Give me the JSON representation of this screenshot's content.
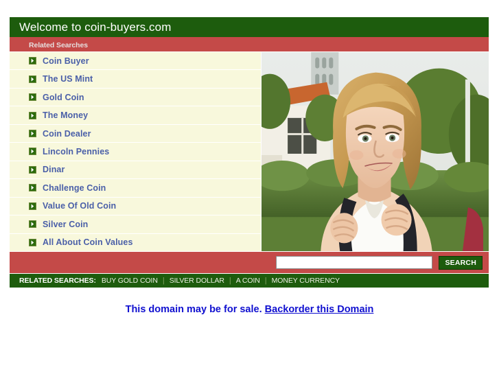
{
  "header": {
    "title": "Welcome to coin-buyers.com",
    "subhead": "Related Searches"
  },
  "colors": {
    "header_green": "#1d5c0d",
    "bar_red": "#c44a48",
    "list_cream": "#f8f8dc",
    "link_blue": "#4a5fa8",
    "notice_blue": "#1010d0"
  },
  "related_links": [
    {
      "label": "Coin Buyer"
    },
    {
      "label": "The US Mint"
    },
    {
      "label": "Gold Coin"
    },
    {
      "label": "The Money"
    },
    {
      "label": "Coin Dealer"
    },
    {
      "label": "Lincoln Pennies"
    },
    {
      "label": "Dinar"
    },
    {
      "label": "Challenge Coin"
    },
    {
      "label": "Value Of Old Coin"
    },
    {
      "label": "Silver Coin"
    },
    {
      "label": "All About Coin Values"
    }
  ],
  "photo": {
    "alt": "smiling blonde woman wearing a backpack outdoors"
  },
  "search": {
    "value": "",
    "placeholder": "",
    "button_label": "SEARCH"
  },
  "footer": {
    "label": "RELATED SEARCHES:",
    "separator": "|",
    "links": [
      {
        "label": "BUY GOLD COIN"
      },
      {
        "label": "SILVER DOLLAR"
      },
      {
        "label": "A COIN"
      },
      {
        "label": "MONEY CURRENCY"
      }
    ]
  },
  "notice": {
    "text": "This domain may be for sale.",
    "link_label": "Backorder this Domain"
  },
  "icons": {
    "bullet": "arrow-right-icon"
  }
}
